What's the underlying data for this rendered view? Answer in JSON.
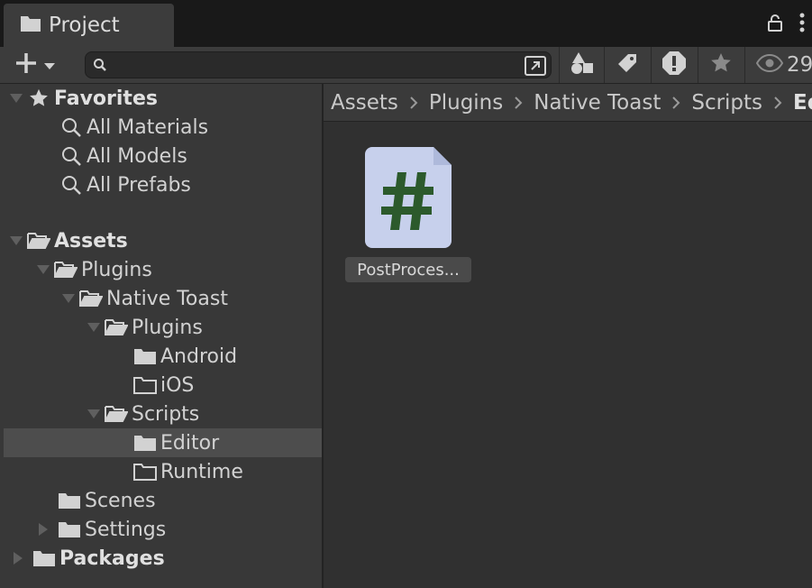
{
  "window": {
    "tab_label": "Project",
    "tab_icon": "folder-icon"
  },
  "toolbar": {
    "search": {
      "value": "",
      "placeholder": ""
    },
    "hidden_count": "29"
  },
  "tree": {
    "favorites": {
      "label": "Favorites",
      "items": [
        {
          "label": "All Materials"
        },
        {
          "label": "All Models"
        },
        {
          "label": "All Prefabs"
        }
      ]
    },
    "assets": {
      "label": "Assets",
      "plugins": "Plugins",
      "native_toast": "Native Toast",
      "nt_plugins": "Plugins",
      "android": "Android",
      "ios": "iOS",
      "scripts": "Scripts",
      "editor": "Editor",
      "runtime": "Runtime",
      "scenes": "Scenes",
      "settings": "Settings"
    },
    "packages": {
      "label": "Packages"
    }
  },
  "breadcrumb": [
    "Assets",
    "Plugins",
    "Native Toast",
    "Scripts",
    "Editor"
  ],
  "files": [
    {
      "name": "PostProces...",
      "icon": "csharp-script-icon"
    }
  ],
  "colors": {
    "script_icon_bg": "#c7d0ec",
    "script_icon_fg": "#2c5a2c",
    "selected_row": "#4d4d4d"
  }
}
